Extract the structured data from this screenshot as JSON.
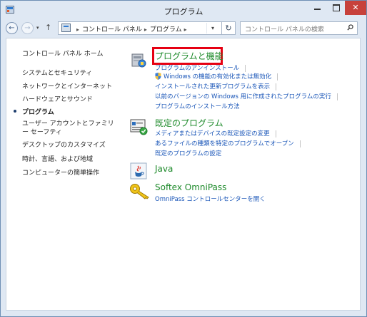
{
  "window": {
    "title": "プログラム",
    "close_label": "✕"
  },
  "navbar": {
    "back_label": "←",
    "forward_label": "→",
    "history_label": "▾",
    "up_label": "↑",
    "breadcrumbs": [
      "コントロール パネル",
      "プログラム"
    ],
    "breadcrumb_sep": "▸",
    "refresh_label": "↻",
    "dropdown_label": "▾",
    "search_placeholder": "コントロール パネルの検索"
  },
  "sidebar": {
    "items": [
      {
        "label": "コントロール パネル ホーム"
      },
      {
        "label": "システムとセキュリティ"
      },
      {
        "label": "ネットワークとインターネット"
      },
      {
        "label": "ハードウェアとサウンド"
      },
      {
        "label": "プログラム",
        "current": true
      },
      {
        "label": "ユーザー アカウントとファミリー セーフティ"
      },
      {
        "label": "デスクトップのカスタマイズ"
      },
      {
        "label": "時計、言語、および地域"
      },
      {
        "label": "コンピューターの簡単操作"
      }
    ]
  },
  "categories": [
    {
      "title": "プログラムと機能",
      "icon": "programs-icon",
      "links": [
        "プログラムのアンインストール",
        "Windows の機能の有効化または無効化",
        "インストールされた更新プログラムを表示",
        "以前のバージョンの Windows 用に作成されたプログラムの実行",
        "プログラムのインストール方法"
      ]
    },
    {
      "title": "既定のプログラム",
      "icon": "default-programs-icon",
      "links": [
        "メディアまたはデバイスの既定設定の変更",
        "あるファイルの種類を特定のプログラムでオープン",
        "既定のプログラムの設定"
      ]
    },
    {
      "title": "Java",
      "icon": "java-icon",
      "links": []
    },
    {
      "title": "Softex OmniPass",
      "icon": "key-icon",
      "links": [
        "OmniPass コントロールセンターを開く"
      ]
    }
  ],
  "colors": {
    "category_title": "#1d8a2a",
    "link": "#1a56b8",
    "highlight_border": "#e60012",
    "close_button": "#c7413b"
  }
}
